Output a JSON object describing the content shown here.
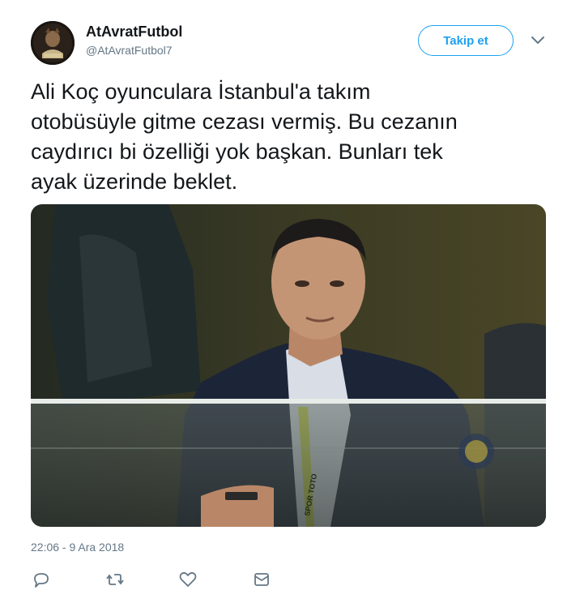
{
  "tweet": {
    "display_name": "AtAvratFutbol",
    "handle": "@AtAvratFutbol7",
    "follow_label": "Takip et",
    "text_lines": [
      "Ali Koç oyunculara İstanbul'a takım",
      "otobüsüyle gitme cezası vermiş. Bu cezanın",
      "caydırıcı bi özelliği yok başkan. Bunları tek",
      "ayak üzerinde beklet."
    ],
    "timestamp": "22:06 - 9 Ara 2018",
    "photo_lanyard_text": "SPOR TOTO"
  },
  "icons": {
    "more": "chevron-down-icon",
    "reply": "reply-icon",
    "retweet": "retweet-icon",
    "like": "heart-icon",
    "dm": "envelope-icon"
  },
  "colors": {
    "accent": "#1da1f2",
    "text": "#14171a",
    "secondary": "#657786"
  }
}
